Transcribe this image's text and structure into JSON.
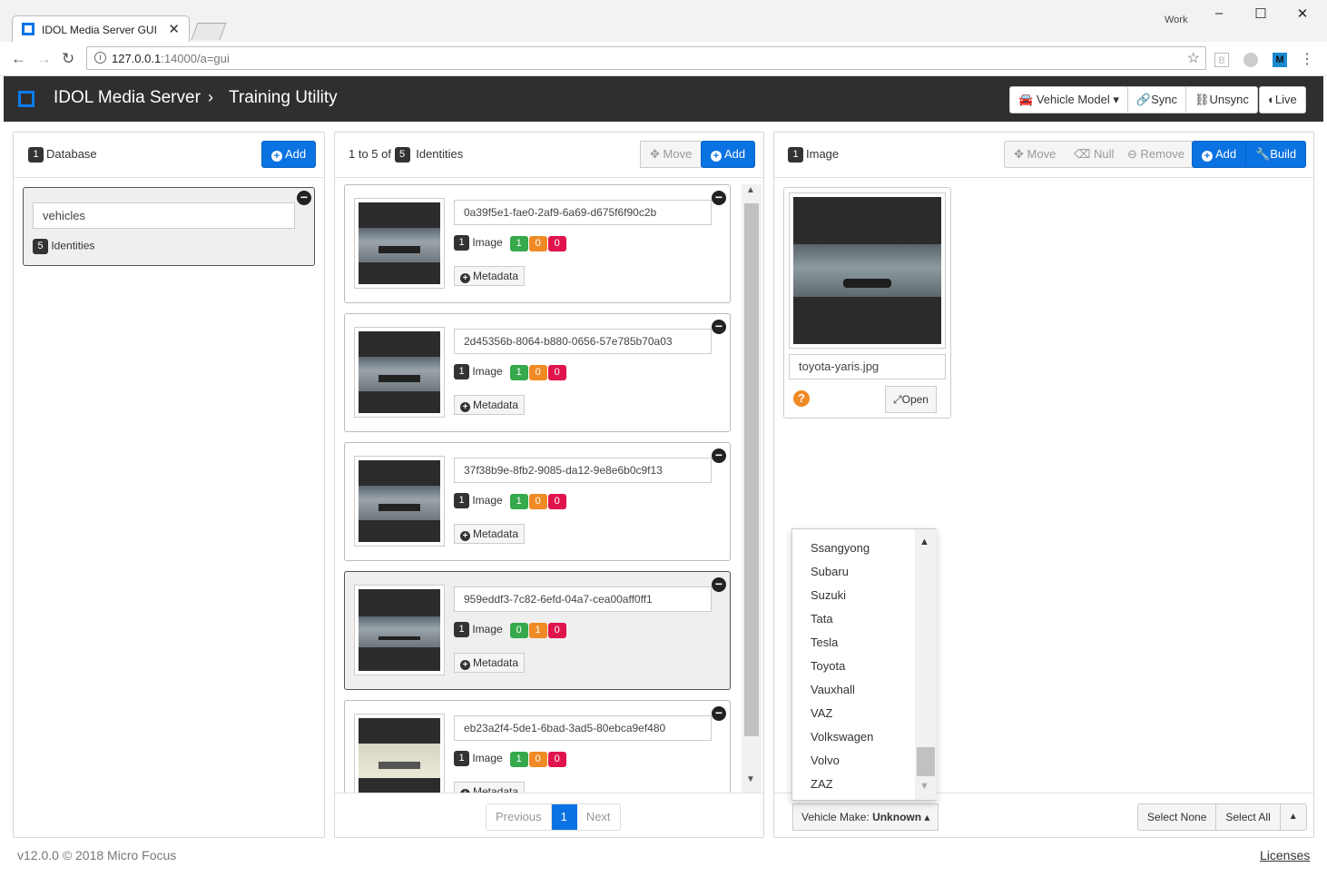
{
  "browser": {
    "tab_title": "IDOL Media Server GUI",
    "profile": "Work",
    "url_host": "127.0.0.1",
    "url_rest": ":14000/a=gui"
  },
  "app": {
    "brand": "IDOL Media Server",
    "crumb_sep": "›",
    "crumb": "Training Utility",
    "buttons": {
      "vehicle_model": "Vehicle Model",
      "sync": "Sync",
      "unsync": "Unsync",
      "live": "Live"
    }
  },
  "database_panel": {
    "count": "1",
    "label": "Database",
    "add": "Add",
    "item": {
      "name": "vehicles",
      "identities_count": "5",
      "identities_label": "Identities"
    }
  },
  "identities_panel": {
    "range": "1 to 5 of",
    "count": "5",
    "label": "Identities",
    "move": "Move",
    "add": "Add",
    "items": [
      {
        "id": "0a39f5e1-fae0-2af9-6a69-d675f6f90c2b",
        "img_count": "1",
        "img_label": "Image",
        "green": "1",
        "orange": "0",
        "red": "0",
        "metadata": "Metadata"
      },
      {
        "id": "2d45356b-8064-b880-0656-57e785b70a03",
        "img_count": "1",
        "img_label": "Image",
        "green": "1",
        "orange": "0",
        "red": "0",
        "metadata": "Metadata"
      },
      {
        "id": "37f38b9e-8fb2-9085-da12-9e8e6b0c9f13",
        "img_count": "1",
        "img_label": "Image",
        "green": "1",
        "orange": "0",
        "red": "0",
        "metadata": "Metadata"
      },
      {
        "id": "959eddf3-7c82-6efd-04a7-cea00aff0ff1",
        "img_count": "1",
        "img_label": "Image",
        "green": "0",
        "orange": "1",
        "red": "0",
        "metadata": "Metadata"
      },
      {
        "id": "eb23a2f4-5de1-6bad-3ad5-80ebca9ef480",
        "img_count": "1",
        "img_label": "Image",
        "green": "1",
        "orange": "0",
        "red": "0",
        "metadata": "Metadata"
      }
    ],
    "pager": {
      "previous": "Previous",
      "page": "1",
      "next": "Next"
    }
  },
  "image_panel": {
    "count": "1",
    "label": "Image",
    "move": "Move",
    "null": "Null",
    "remove": "Remove",
    "add": "Add",
    "build": "Build",
    "image": {
      "filename": "toyota-yaris.jpg",
      "open": "Open",
      "help": "?"
    },
    "vehicle_make_label": "Vehicle Make:",
    "vehicle_make_value": "Unknown",
    "select_none": "Select None",
    "select_all": "Select All"
  },
  "make_dropdown": [
    "Ssangyong",
    "Subaru",
    "Suzuki",
    "Tata",
    "Tesla",
    "Toyota",
    "Vauxhall",
    "VAZ",
    "Volkswagen",
    "Volvo",
    "ZAZ"
  ],
  "footer": {
    "version": "v12.0.0 © 2018 Micro Focus",
    "licenses": "Licenses"
  }
}
